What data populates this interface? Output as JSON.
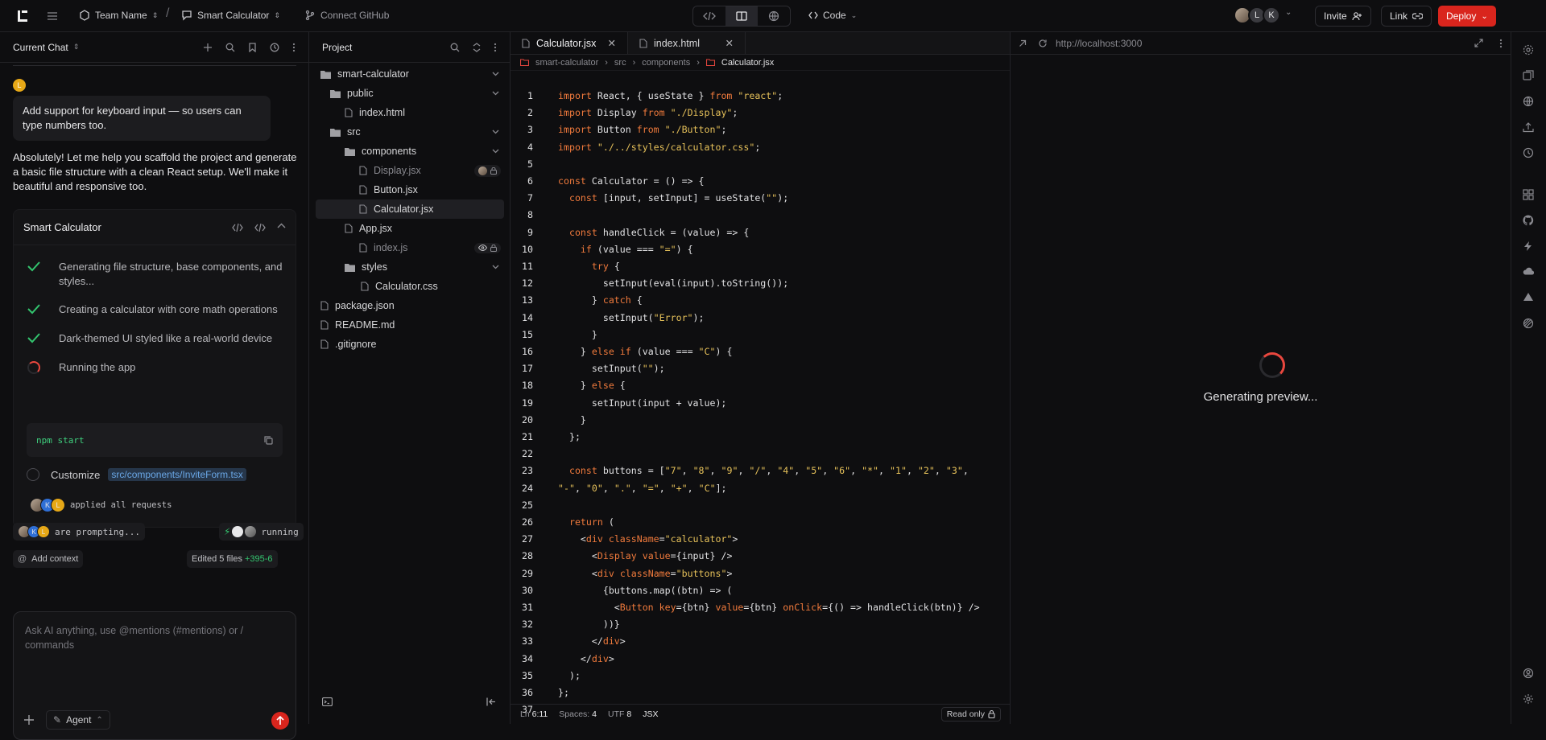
{
  "topbar": {
    "team": "Team Name",
    "project": "Smart Calculator",
    "github": "Connect GitHub",
    "mode": "Code",
    "avatars": [
      "L",
      "K"
    ],
    "invite": "Invite",
    "link": "Link",
    "deploy": "Deploy"
  },
  "chat": {
    "header": "Current Chat",
    "user_initial": "L",
    "user_message": "Add support for keyboard input — so users can type numbers too.",
    "ai_message": "Absolutely! Let me help you scaffold the project and generate a basic file structure with a clean React setup. We'll make it beautiful and responsive too.",
    "card_title": "Smart Calculator",
    "steps": [
      "Generating file structure, base components, and styles...",
      "Creating a calculator with core math operations",
      "Dark-themed UI styled like a real-world device",
      "Running the app"
    ],
    "command": "npm start",
    "customize_label": "Customize",
    "customize_path": "src/components/InviteForm.tsx",
    "applied_text": "applied all requests",
    "prompting_text": "are prompting...",
    "running_text": "running",
    "add_context": "Add context",
    "edited_files": "Edited 5 files",
    "diff_stat": "+395-6",
    "composer_placeholder": "Ask AI anything, use @mentions (#mentions) or / commands",
    "agent_label": "Agent",
    "avatar_initials": [
      "K",
      "L"
    ]
  },
  "tree": {
    "header": "Project",
    "items": [
      {
        "name": "smart-calculator"
      },
      {
        "name": "public"
      },
      {
        "name": "index.html"
      },
      {
        "name": "src"
      },
      {
        "name": "components"
      },
      {
        "name": "Display.jsx"
      },
      {
        "name": "Button.jsx"
      },
      {
        "name": "Calculator.jsx"
      },
      {
        "name": "App.jsx"
      },
      {
        "name": "index.js"
      },
      {
        "name": "styles"
      },
      {
        "name": "Calculator.css"
      },
      {
        "name": "package.json"
      },
      {
        "name": "README.md"
      },
      {
        "name": ".gitignore"
      }
    ]
  },
  "editor": {
    "tabs": [
      "Calculator.jsx",
      "index.html"
    ],
    "breadcrumb": [
      "smart-calculator",
      "src",
      "components",
      "Calculator.jsx"
    ],
    "lines": [
      "import React, { useState } from \"react\";",
      "import Display from \"./Display\";",
      "import Button from \"./Button\";",
      "import \"./../styles/calculator.css\";",
      "",
      "const Calculator = () => {",
      "  const [input, setInput] = useState(\"\");",
      "",
      "  const handleClick = (value) => {",
      "    if (value === \"=\") {",
      "      try {",
      "        setInput(eval(input).toString());",
      "      } catch {",
      "        setInput(\"Error\");",
      "      }",
      "    } else if (value === \"C\") {",
      "      setInput(\"\");",
      "    } else {",
      "      setInput(input + value);",
      "    }",
      "  };",
      "",
      "  const buttons = [\"7\", \"8\", \"9\", \"/\", \"4\", \"5\", \"6\", \"*\", \"1\", \"2\", \"3\",",
      "\"-\", \"0\", \".\", \"=\", \"+\", \"C\"];",
      "",
      "  return (",
      "    <div className=\"calculator\">",
      "      <Display value={input} />",
      "      <div className=\"buttons\">",
      "        {buttons.map((btn) => (",
      "          <Button key={btn} value={btn} onClick={() => handleClick(btn)} />",
      "        ))}",
      "      </div>",
      "    </div>",
      "  );",
      "};",
      ""
    ],
    "status": {
      "ln_label": "Ln",
      "ln_value": "6:11",
      "spaces_label": "Spaces:",
      "spaces_value": "4",
      "enc_label": "UTF",
      "enc_value": "8",
      "lang": "JSX",
      "readonly": "Read only"
    }
  },
  "preview": {
    "url": "http://localhost:3000",
    "status": "Generating preview..."
  },
  "colors": {
    "accent": "#d9251d",
    "success": "#33c46e",
    "keyword": "#f07a3c",
    "string": "#e6c15a",
    "avatar_gold": "#e6a817",
    "avatar_blue": "#2f6fd6"
  }
}
